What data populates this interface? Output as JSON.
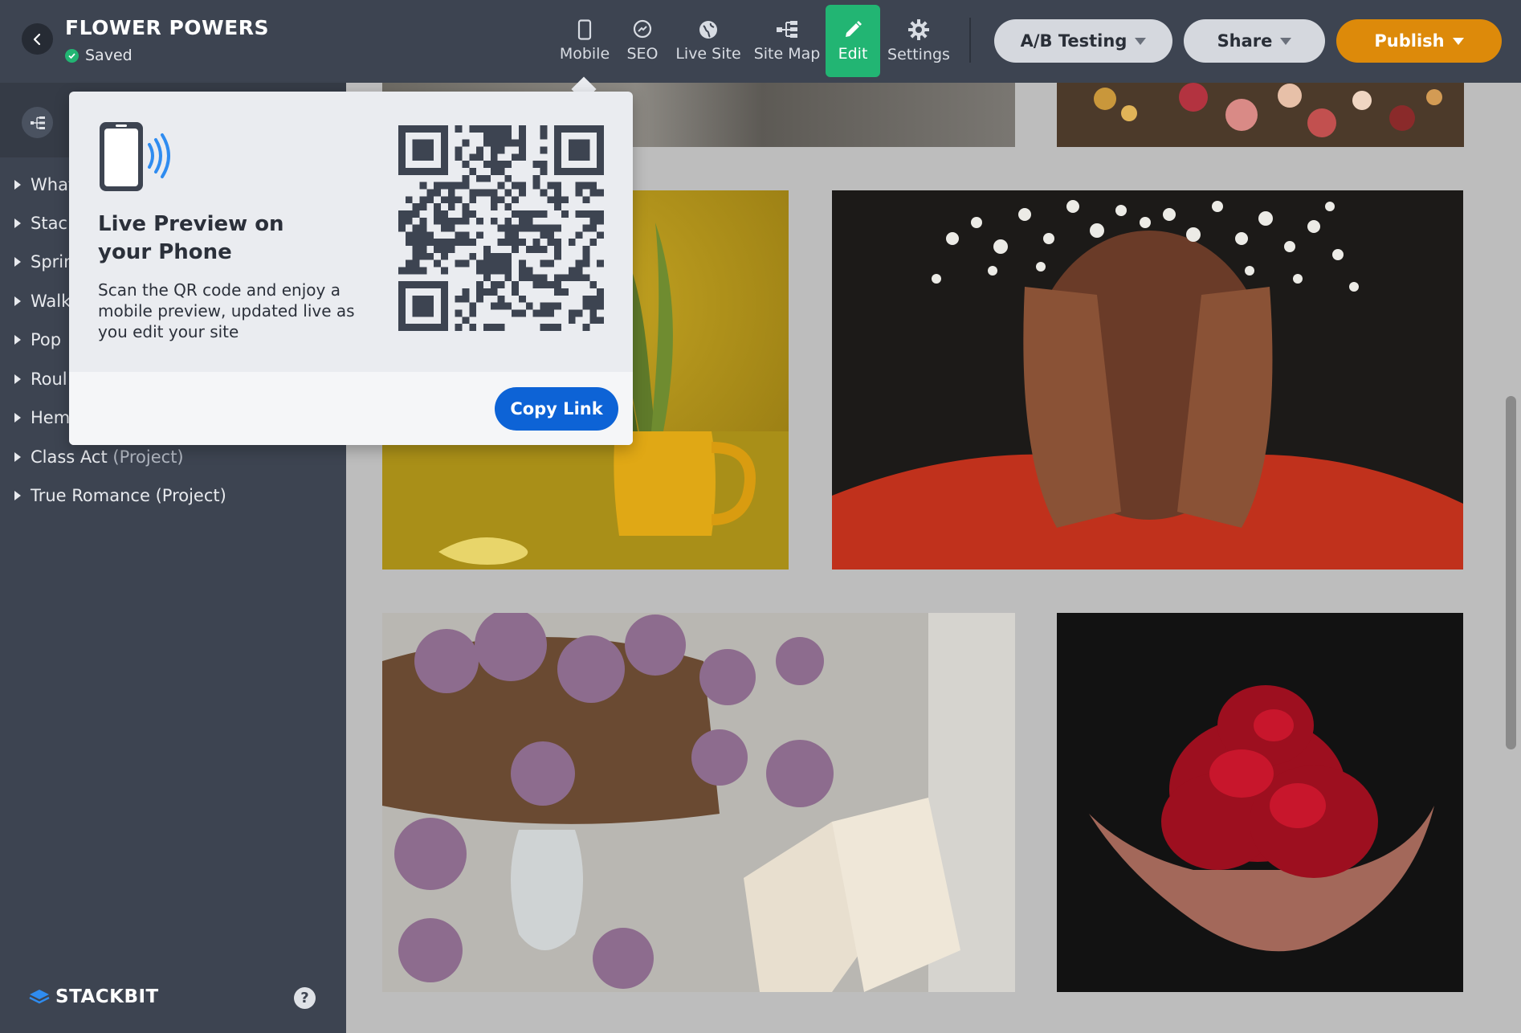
{
  "header": {
    "site_title": "FLOWER POWERS",
    "save_status": "Saved",
    "nav": {
      "mobile": "Mobile",
      "seo": "SEO",
      "live_site": "Live Site",
      "site_map": "Site Map",
      "edit": "Edit",
      "settings": "Settings"
    },
    "ab_testing": "A/B Testing",
    "share": "Share",
    "publish": "Publish"
  },
  "sidebar": {
    "items": [
      {
        "label": "What"
      },
      {
        "label": "Stac"
      },
      {
        "label": "Sprin"
      },
      {
        "label": "Walk"
      },
      {
        "label": "Pop"
      },
      {
        "label": "Roul"
      },
      {
        "label": "Hem"
      },
      {
        "label": "Class Act",
        "suffix": "(Project)"
      },
      {
        "label": "True Romance",
        "suffix": "(Project)"
      }
    ],
    "brand": "STACKBIT",
    "help": "?"
  },
  "popover": {
    "title": "Live Preview on your Phone",
    "description": "Scan the QR code and enjoy a mobile preview, updated live as you edit your site",
    "copy_link": "Copy Link"
  },
  "colors": {
    "topbar": "#3d4451",
    "edit_active": "#22b573",
    "publish": "#dd8a0a",
    "copy_link": "#0d63d6"
  }
}
